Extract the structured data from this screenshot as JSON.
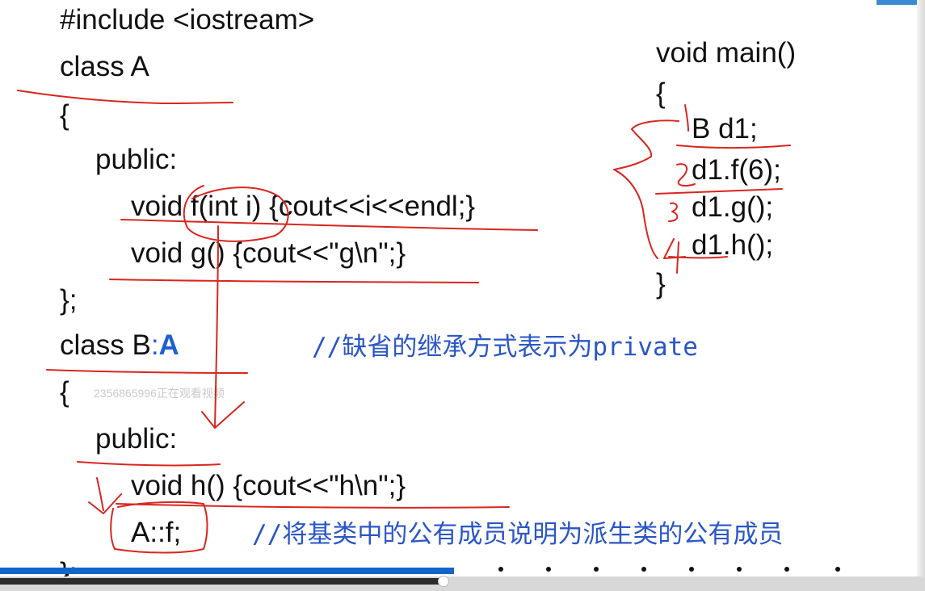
{
  "code": {
    "include": "#include <iostream>",
    "class_a": "class A",
    "open_brace_1": "{",
    "public_1": "public:",
    "f_decl": "void f(int i) {cout<<i<<endl;}",
    "g_decl": "void g() {cout<<\"g\\n\";}",
    "close_a": "};",
    "class_b_prefix": "class B",
    "class_b_colon": ":",
    "class_b_base": "A",
    "comment_inherit": "//缺省的继承方式表示为private",
    "open_brace_2": "{",
    "public_2": "public:",
    "h_decl": "void h() {cout<<\"h\\n\";}",
    "using_f": "A::f;",
    "comment_public": "//将基类中的公有成员说明为派生类的公有成员",
    "close_b": "};"
  },
  "main_code": {
    "signature": "void main()",
    "open_brace": "{",
    "stmt_1": "B d1;",
    "stmt_2": "d1.f(6);",
    "stmt_3": "d1.g();",
    "stmt_4": "d1.h();",
    "close_brace": "}"
  },
  "watermark": "2356865996正在观看视频",
  "player": {
    "progress_fraction": 0.48
  },
  "colors": {
    "annotation_ink": "#d8261e",
    "keyword_blue": "#1f5fcf",
    "progress_blue": "#1465c9"
  }
}
